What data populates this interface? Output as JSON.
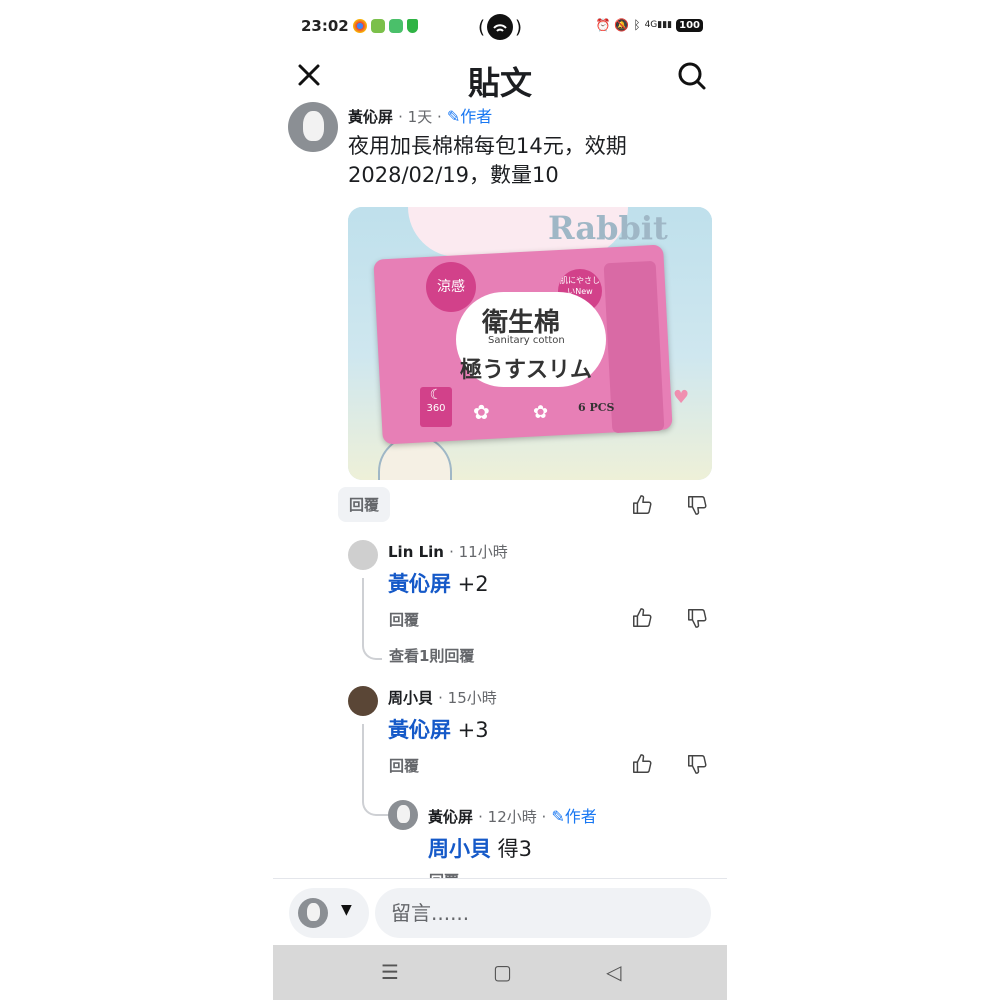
{
  "status_bar": {
    "time": "23:02",
    "battery": "100",
    "network": "4G"
  },
  "header": {
    "title": "貼文",
    "close_icon": "close-icon",
    "search_icon": "search-icon"
  },
  "post": {
    "author": "黃伈屏",
    "time": "· 1天 ·",
    "author_badge": "作者",
    "text_line1": "夜用加長棉棉每包14元，效期",
    "text_line2": "2028/02/19，數量10",
    "reply_label": "回覆",
    "photo_text": {
      "banner": "Rabbit",
      "badge_left": "涼感",
      "badge_right": "肌にやさしいNew",
      "product_line1": "衛生棉",
      "product_sub": "Sanitary cotton",
      "product_line2": "極うすスリム",
      "size": "360",
      "count": "6 PCS"
    }
  },
  "comments": [
    {
      "author": "Lin Lin",
      "time": "· 11小時",
      "tag": "黃伈屏",
      "text": " +2",
      "reply_label": "回覆",
      "view_replies": "查看1則回覆"
    },
    {
      "author": "周小貝",
      "time": "· 15小時",
      "tag": "黃伈屏",
      "text": " +3",
      "reply_label": "回覆",
      "reply": {
        "author": "黃伈屏",
        "time": "· 12小時 ·",
        "author_badge": "作者",
        "tag": "周小貝",
        "text": " 得3",
        "reply_label": "回覆"
      }
    }
  ],
  "composer": {
    "placeholder": "留言......"
  },
  "colors": {
    "accent": "#1877f2",
    "tag": "#1559c8",
    "pink": "#e77fb6"
  }
}
